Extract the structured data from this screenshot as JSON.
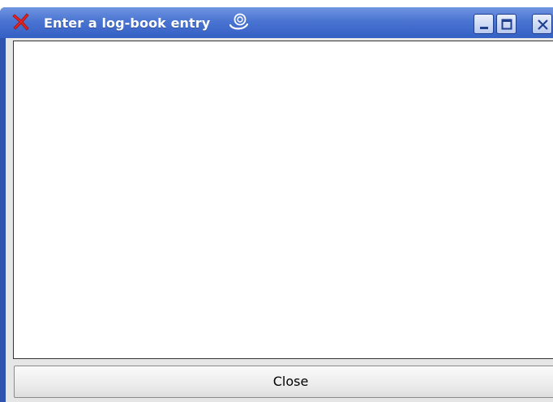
{
  "window": {
    "title": "Enter a log-book entry",
    "icon": "red-x-app-icon",
    "title_decoration_icon": "swirl-icon",
    "titlebar_color": "#4a74d2",
    "controls": [
      "minimize",
      "maximize",
      "close"
    ]
  },
  "editor": {
    "value": ""
  },
  "buttons": {
    "close_label": "Close"
  }
}
